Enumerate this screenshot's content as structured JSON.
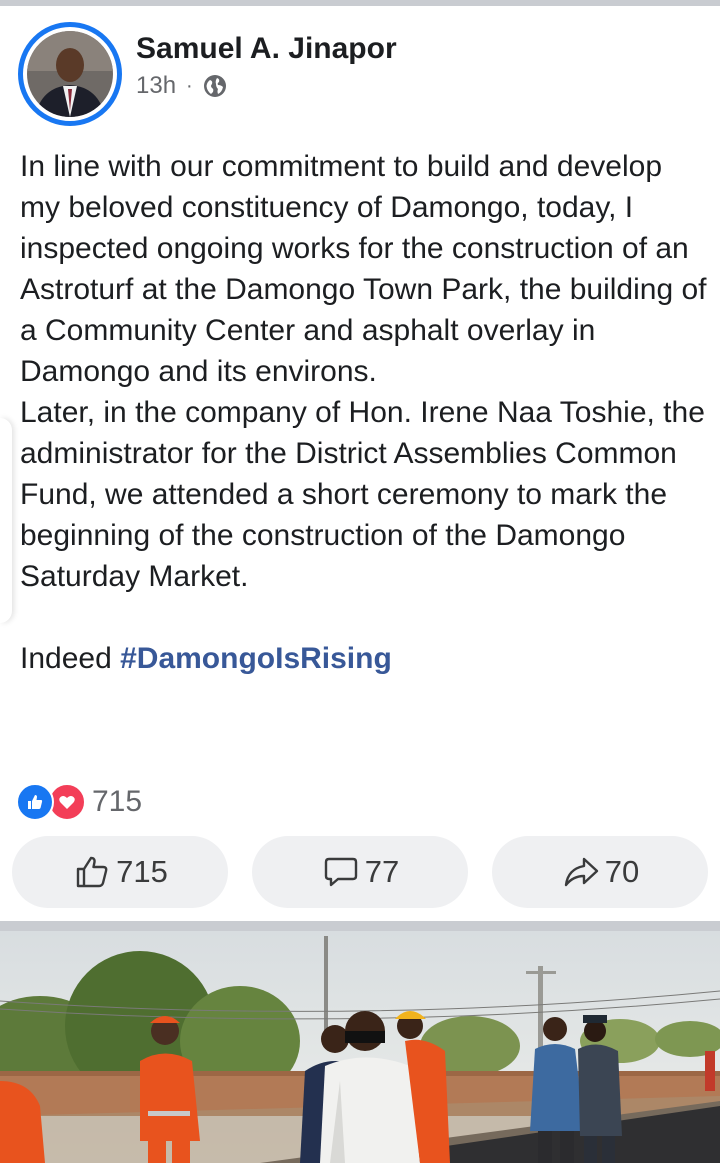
{
  "post": {
    "author": "Samuel A. Jinapor",
    "time": "13h",
    "separator": "·",
    "audience_icon": "globe-icon",
    "paragraphs": [
      "In line with our commitment to build and develop my beloved constituency of Damongo, today, I inspected ongoing works for the construction of an Astroturf at the Damongo Town Park, the building of a Community Center and asphalt overlay in Damongo and its environs.",
      "Later, in the company of Hon. Irene Naa Toshie, the administrator for the District Assemblies Common Fund, we attended a short ceremony to mark the beginning of the construction of  the Damongo Saturday Market."
    ],
    "closing_prefix": "Indeed ",
    "hashtag": "#DamongoIsRising"
  },
  "reactions": {
    "icons": [
      "like-icon",
      "love-icon"
    ],
    "count": "715"
  },
  "actions": {
    "like_count": "715",
    "comment_count": "77",
    "share_count": "70"
  },
  "colors": {
    "accent": "#1877f2",
    "love": "#f33e58",
    "hashtag": "#385898",
    "muted": "#65676b",
    "button_bg": "#eff0f2"
  }
}
